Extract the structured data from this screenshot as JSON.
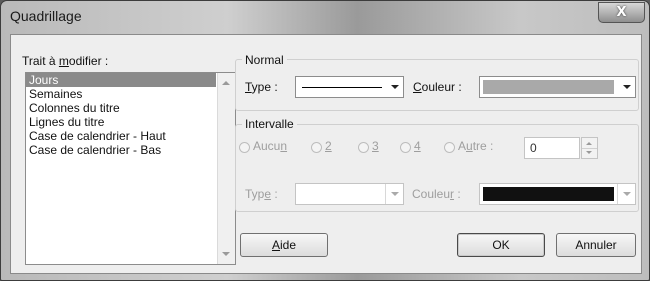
{
  "window": {
    "title": "Quadrillage",
    "close_glyph": "X"
  },
  "left": {
    "label_pre": "Trait à ",
    "label_accel": "m",
    "label_post": "odifier :",
    "items": [
      "Jours",
      "Semaines",
      "Colonnes du titre",
      "Lignes du titre",
      "Case de calendrier - Haut",
      "Case de calendrier - Bas"
    ],
    "selected_index": 0
  },
  "normal": {
    "legend": "Normal",
    "type_accel": "T",
    "type_rest": "ype :",
    "couleur_accel": "C",
    "couleur_rest": "ouleur :",
    "line_color": "#000000",
    "swatch_color": "#a9a9a9"
  },
  "intervalle": {
    "legend": "Intervalle",
    "options": [
      {
        "pre": "Aucu",
        "accel": "n",
        "post": ""
      },
      {
        "pre": "",
        "accel": "2",
        "post": ""
      },
      {
        "pre": "",
        "accel": "3",
        "post": ""
      },
      {
        "pre": "",
        "accel": "4",
        "post": ""
      },
      {
        "pre": "A",
        "accel": "u",
        "post": "tre :"
      }
    ],
    "autre_value": "0",
    "type_pre": "Typ",
    "type_accel": "e",
    "type_post": " :",
    "couleur_pre": "Couleu",
    "couleur_accel": "r",
    "couleur_post": " :",
    "swatch_color": "#111111"
  },
  "buttons": {
    "aide_accel": "A",
    "aide_rest": "ide",
    "ok": "OK",
    "annuler": "Annuler"
  }
}
